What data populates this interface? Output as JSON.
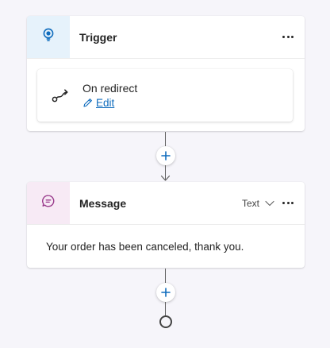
{
  "trigger": {
    "title": "Trigger",
    "icon": "lightbulb-icon",
    "more_icon": "more-horizontal-icon",
    "event": {
      "label": "On redirect",
      "icon": "redirect-icon",
      "edit_label": "Edit",
      "edit_icon": "pencil-icon"
    }
  },
  "connector_1": {
    "add_icon": "plus-icon"
  },
  "message": {
    "title": "Message",
    "icon": "chat-bubble-icon",
    "type_select": "Text",
    "more_icon": "more-horizontal-icon",
    "body": "Your order has been canceled, thank you."
  },
  "connector_2": {
    "add_icon": "plus-icon",
    "end_icon": "end-circle-icon"
  },
  "colors": {
    "accent": "#0f6cbd",
    "trigger_icon_bg": "#e6f2fb",
    "message_icon_bg": "#f7eaf5",
    "add_plus": "#0f6cbd"
  }
}
